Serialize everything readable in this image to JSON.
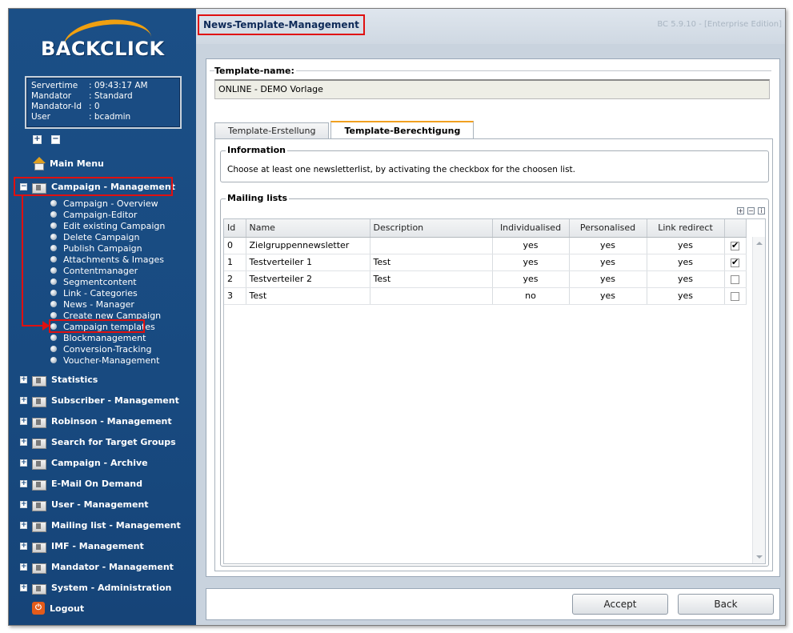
{
  "brand": {
    "name": "BACKCLICK"
  },
  "server_info": [
    {
      "key": "Servertime",
      "value": ": 09:43:17 AM"
    },
    {
      "key": "Mandator",
      "value": ": Standard"
    },
    {
      "key": "Mandator-Id",
      "value": ": 0"
    },
    {
      "key": "User",
      "value": ": bcadmin"
    }
  ],
  "tree_toggles": {
    "expand": "+",
    "collapse": "−"
  },
  "nav": {
    "main_menu": "Main Menu",
    "campaign_management": "Campaign - Management",
    "campaign_sub": [
      "Campaign - Overview",
      "Campaign-Editor",
      "Edit existing Campaign",
      "Delete Campaign",
      "Publish Campaign",
      "Attachments & Images",
      "Contentmanager",
      "Segmentcontent",
      "Link - Categories",
      "News - Manager",
      "Create new Campaign",
      "Campaign templates",
      "Blockmanagement",
      "Conversion-Tracking",
      "Voucher-Management"
    ],
    "sections": [
      "Statistics",
      "Subscriber - Management",
      "Robinson - Management",
      "Search for Target Groups",
      "Campaign - Archive",
      "E-Mail On Demand",
      "User - Management",
      "Mailing list - Management",
      "IMF - Management",
      "Mandator - Management",
      "System - Administration"
    ],
    "logout": "Logout"
  },
  "header": {
    "page_title": "News-Template-Management",
    "version": "BC 5.9.10 - [Enterprise Edition]"
  },
  "template_name": {
    "label": "Template-name:",
    "value": "ONLINE - DEMO  Vorlage"
  },
  "tabs": [
    {
      "label": "Template-Erstellung",
      "active": false
    },
    {
      "label": "Template-Berechtigung",
      "active": true
    }
  ],
  "information": {
    "title": "Information",
    "text": "Choose at least one newsletterlist, by activating the checkbox for the choosen list."
  },
  "mailing_lists": {
    "title": "Mailing lists",
    "columns": [
      "Id",
      "Name",
      "Description",
      "Individualised",
      "Personalised",
      "Link redirect"
    ],
    "rows": [
      {
        "id": "0",
        "name": "Zielgruppennewsletter",
        "description": "",
        "individualised": "yes",
        "personalised": "yes",
        "link_redirect": "yes",
        "checked": true
      },
      {
        "id": "1",
        "name": "Testverteiler 1",
        "description": "Test",
        "individualised": "yes",
        "personalised": "yes",
        "link_redirect": "yes",
        "checked": true
      },
      {
        "id": "2",
        "name": "Testverteiler 2",
        "description": "Test",
        "individualised": "yes",
        "personalised": "yes",
        "link_redirect": "yes",
        "checked": false
      },
      {
        "id": "3",
        "name": "Test",
        "description": "",
        "individualised": "no",
        "personalised": "yes",
        "link_redirect": "yes",
        "checked": false
      }
    ]
  },
  "buttons": {
    "accept": "Accept",
    "back": "Back"
  }
}
